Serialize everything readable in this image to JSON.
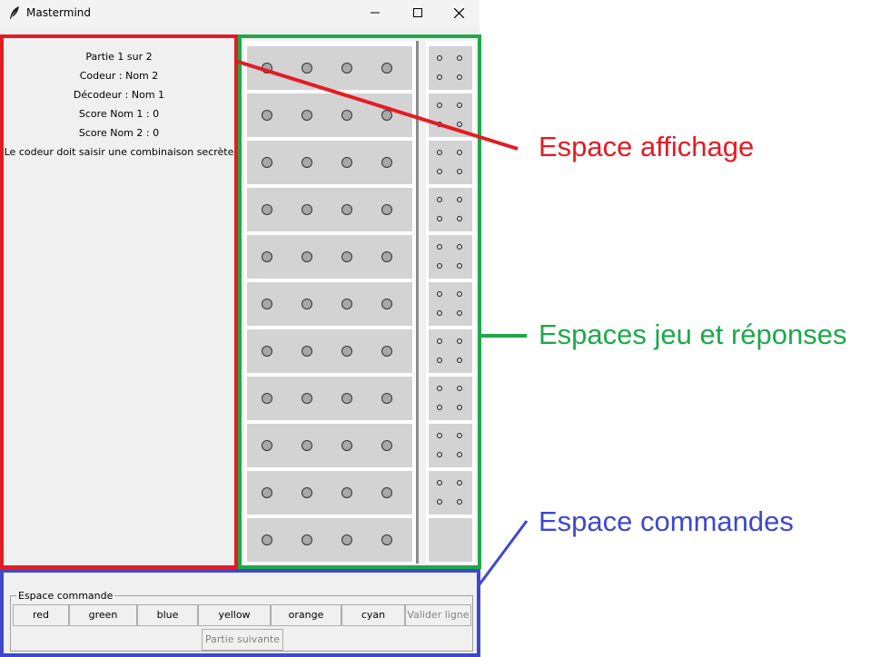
{
  "window": {
    "title": "Mastermind",
    "controls": [
      "minimize",
      "maximize",
      "close"
    ]
  },
  "affichage": {
    "lines": [
      "Partie 1 sur 2",
      "Codeur : Nom 2",
      "Décodeur : Nom 1",
      "Score Nom 1 : 0",
      "Score Nom 2 : 0",
      "Le codeur doit saisir une combinaison secrète"
    ]
  },
  "board": {
    "rows": 11,
    "pegs_per_row": 4,
    "answer_rows_with_dots": 10,
    "colors": {
      "cell_bg": "#d3d3d3",
      "peg_fill": "#a8a8a8"
    }
  },
  "commandes": {
    "legend": "Espace commande",
    "color_buttons": [
      "red",
      "green",
      "blue",
      "yellow",
      "orange",
      "cyan"
    ],
    "validate_label": "Valider ligne",
    "next_label": "Partie suivante"
  },
  "annotations": {
    "affichage": {
      "label": "Espace affichage",
      "color": "#e41b23"
    },
    "jeu": {
      "label": "Espaces jeu et réponses",
      "color": "#1ea84a"
    },
    "commandes": {
      "label": "Espace commandes",
      "color": "#3f48cc"
    }
  }
}
